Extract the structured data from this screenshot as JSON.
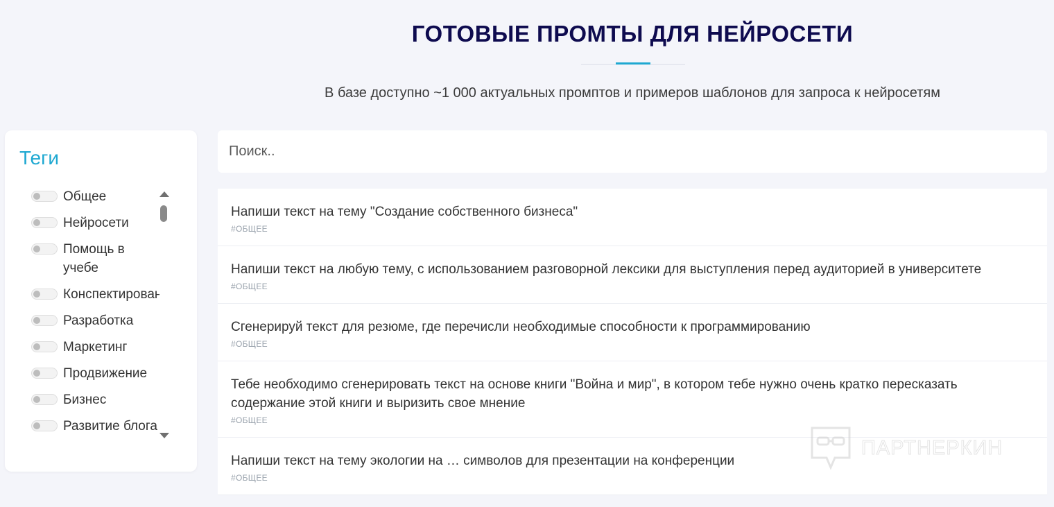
{
  "header": {
    "title": "ГОТОВЫЕ ПРОМТЫ ДЛЯ НЕЙРОСЕТИ",
    "subtitle": "В базе доступно ~1 000 актуальных промптов и примеров шаблонов для запроса к нейросетям"
  },
  "tags": {
    "title": "Теги",
    "items": [
      {
        "label": "Общее"
      },
      {
        "label": "Нейросети"
      },
      {
        "label": "Помощь в учебе"
      },
      {
        "label": "Конспектирование"
      },
      {
        "label": "Разработка"
      },
      {
        "label": "Маркетинг"
      },
      {
        "label": "Продвижение"
      },
      {
        "label": "Бизнес"
      },
      {
        "label": "Развитие блога"
      }
    ]
  },
  "search": {
    "placeholder": "Поиск.."
  },
  "results": [
    {
      "text": "Напиши текст на тему \"Создание собственного бизнеса\"",
      "tag": "#ОБЩЕЕ"
    },
    {
      "text": "Напиши текст на любую тему, с использованием разговорной лексики для выступления перед аудиторией в университете",
      "tag": "#ОБЩЕЕ"
    },
    {
      "text": "Сгенерируй текст для резюме, где перечисли необходимые способности к программированию",
      "tag": "#ОБЩЕЕ"
    },
    {
      "text": "Тебе необходимо сгенерировать текст на основе книги \"Война и мир\", в котором тебе нужно очень кратко пересказать содержание этой книги и выризить свое мнение",
      "tag": "#ОБЩЕЕ"
    },
    {
      "text": "Напиши текст на тему экологии на … символов для презентации на конференции",
      "tag": "#ОБЩЕЕ"
    }
  ],
  "watermark": {
    "text": "ПАРТНЕРКИН"
  },
  "colors": {
    "background": "#f4f5fa",
    "title": "#0e0b4f",
    "accent": "#1ea8d1",
    "tag_text": "#9aa3ad"
  }
}
